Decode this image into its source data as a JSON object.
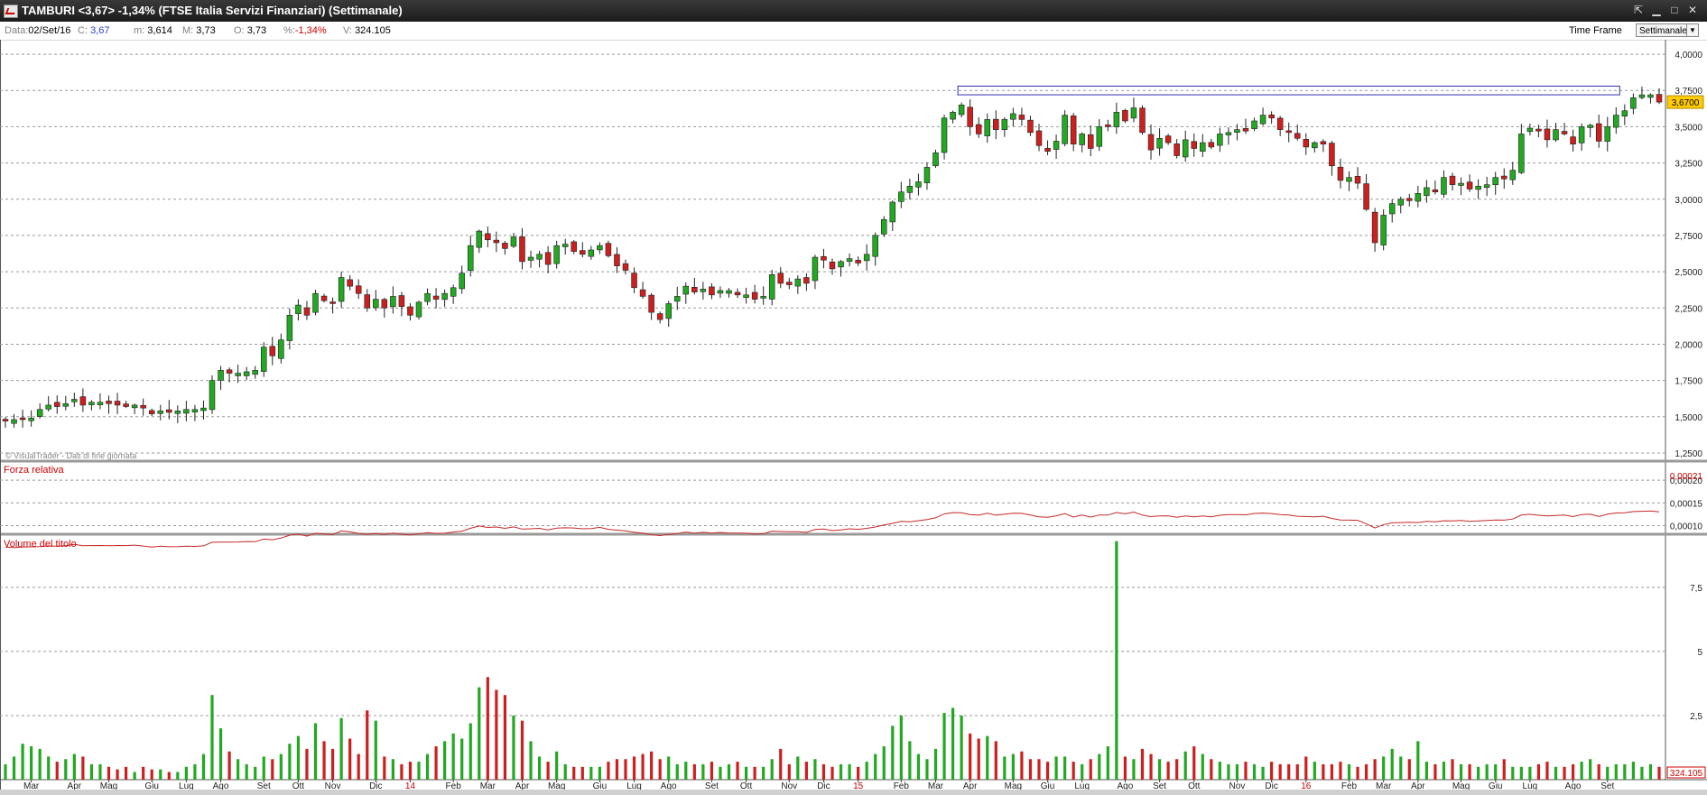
{
  "window": {
    "title": "TAMBURI <3,67> -1,34% (FTSE Italia Servizi Finanziari) (Settimanale)",
    "buttons": [
      "pin-icon",
      "minimize-icon",
      "maximize-icon",
      "close-icon"
    ]
  },
  "info": {
    "date_label": "Data:",
    "date_value": "02/Set/16",
    "close_label": "C:",
    "close_value": "3,67",
    "min_label": "m:",
    "min_value": "3,614",
    "max_label": "M:",
    "max_value": "3,73",
    "open_label": "O:",
    "open_value": "3,73",
    "pct_label": "%:",
    "pct_value": "-1,34%",
    "vol_label": "V:",
    "vol_value": "324.105",
    "timeframe_label": "Time Frame",
    "timeframe_value": "Settimanale"
  },
  "colors": {
    "up": "#22a822",
    "down": "#cc1f1f",
    "line": "#c62828",
    "rect": "#2f2fb0",
    "label_red": "#cc0000",
    "price_tag": "#ffcc00"
  },
  "chart_data": [
    {
      "type": "candlestick",
      "watermark": "© VisualTrader - Dati di fine giornata",
      "price_tag": "3,6700",
      "ylim": [
        1.2,
        4.1
      ],
      "yticks": [
        "4,0000",
        "3,7500",
        "3,5000",
        "3,2500",
        "3,0000",
        "2,7500",
        "2,5000",
        "2,2500",
        "2,0000",
        "1,7500",
        "1,5000",
        "1,2500"
      ],
      "ytick_values": [
        4.0,
        3.75,
        3.5,
        3.25,
        3.0,
        2.75,
        2.5,
        2.25,
        2.0,
        1.75,
        1.5,
        1.25
      ],
      "resistance_zone": {
        "y_low": 3.72,
        "y_high": 3.78,
        "from_week": 111,
        "to_week": 187
      },
      "closes": [
        1.47,
        1.48,
        1.48,
        1.49,
        1.55,
        1.58,
        1.57,
        1.59,
        1.62,
        1.58,
        1.6,
        1.6,
        1.59,
        1.58,
        1.57,
        1.58,
        1.56,
        1.52,
        1.54,
        1.53,
        1.54,
        1.55,
        1.55,
        1.56,
        1.75,
        1.82,
        1.8,
        1.8,
        1.81,
        1.82,
        1.98,
        1.92,
        2.03,
        2.2,
        2.27,
        2.2,
        2.35,
        2.3,
        2.28,
        2.46,
        2.4,
        2.35,
        2.25,
        2.31,
        2.25,
        2.33,
        2.26,
        2.2,
        2.29,
        2.35,
        2.31,
        2.35,
        2.39,
        2.49,
        2.68,
        2.78,
        2.72,
        2.7,
        2.66,
        2.74,
        2.57,
        2.6,
        2.62,
        2.55,
        2.68,
        2.69,
        2.64,
        2.62,
        2.65,
        2.68,
        2.61,
        2.54,
        2.51,
        2.39,
        2.33,
        2.22,
        2.17,
        2.28,
        2.33,
        2.4,
        2.36,
        2.38,
        2.34,
        2.37,
        2.37,
        2.34,
        2.34,
        2.31,
        2.33,
        2.48,
        2.42,
        2.41,
        2.45,
        2.42,
        2.6,
        2.58,
        2.52,
        2.57,
        2.59,
        2.56,
        2.62,
        2.75,
        2.86,
        2.98,
        3.05,
        3.09,
        3.12,
        3.22,
        3.32,
        3.56,
        3.6,
        3.65,
        3.5,
        3.45,
        3.55,
        3.48,
        3.55,
        3.59,
        3.55,
        3.46,
        3.37,
        3.33,
        3.4,
        3.58,
        3.38,
        3.45,
        3.35,
        3.5,
        3.5,
        3.6,
        3.54,
        3.63,
        3.46,
        3.34,
        3.42,
        3.39,
        3.3,
        3.41,
        3.35,
        3.39,
        3.36,
        3.45,
        3.46,
        3.48,
        3.47,
        3.54,
        3.58,
        3.56,
        3.48,
        3.46,
        3.42,
        3.36,
        3.39,
        3.38,
        3.23,
        3.13,
        3.15,
        3.11,
        2.93,
        2.7,
        2.89,
        2.97,
        3.0,
        2.99,
        3.04,
        3.08,
        3.05,
        3.15,
        3.1,
        3.11,
        3.07,
        3.09,
        3.1,
        3.15,
        3.14,
        3.2,
        3.45,
        3.49,
        3.47,
        3.41,
        3.48,
        3.45,
        3.38,
        3.5,
        3.51,
        3.4,
        3.5,
        3.58,
        3.61,
        3.7,
        3.72,
        3.72,
        3.67
      ],
      "volume_ylim": [
        0,
        9.5
      ],
      "volume_yticks": [
        "7,5",
        "5",
        "2,5"
      ],
      "volume_ytick_values": [
        7.5,
        5,
        2.5
      ],
      "volume_label": "Volume del titolo",
      "volume_last": "324.105",
      "volumes": [
        0.6,
        0.9,
        1.4,
        1.3,
        1.2,
        0.9,
        0.7,
        0.8,
        1.0,
        0.9,
        0.6,
        0.6,
        0.5,
        0.4,
        0.5,
        0.3,
        0.5,
        0.4,
        0.4,
        0.3,
        0.3,
        0.5,
        0.6,
        1.0,
        3.3,
        2.0,
        1.1,
        0.8,
        0.6,
        0.5,
        0.9,
        0.8,
        1.0,
        1.4,
        1.7,
        1.2,
        2.2,
        1.5,
        1.2,
        2.4,
        1.6,
        1.0,
        2.7,
        2.3,
        0.9,
        0.8,
        0.6,
        0.7,
        0.7,
        1.0,
        1.3,
        1.5,
        1.8,
        1.6,
        2.2,
        3.6,
        4.0,
        3.5,
        3.3,
        2.5,
        2.3,
        1.5,
        0.9,
        0.7,
        1.1,
        0.6,
        0.5,
        0.5,
        0.5,
        0.5,
        0.7,
        0.8,
        0.8,
        0.9,
        1.0,
        1.1,
        0.8,
        0.9,
        0.6,
        0.7,
        0.6,
        0.6,
        0.7,
        0.5,
        0.6,
        0.7,
        0.5,
        0.5,
        0.5,
        0.8,
        1.2,
        0.6,
        0.9,
        0.7,
        0.8,
        0.6,
        0.5,
        0.6,
        0.6,
        0.5,
        0.7,
        1.0,
        1.3,
        2.1,
        2.5,
        1.5,
        1.0,
        0.8,
        1.2,
        2.6,
        2.8,
        2.5,
        1.8,
        1.6,
        1.7,
        1.5,
        0.9,
        1.0,
        1.1,
        0.8,
        0.8,
        0.7,
        0.9,
        0.9,
        0.7,
        0.6,
        0.8,
        1.0,
        1.3,
        9.3,
        0.9,
        0.8,
        1.2,
        1.0,
        0.8,
        0.7,
        0.8,
        1.1,
        1.3,
        1.0,
        0.8,
        0.7,
        0.6,
        0.6,
        0.7,
        0.6,
        0.5,
        0.7,
        0.6,
        0.6,
        0.6,
        0.9,
        0.7,
        0.6,
        0.6,
        0.7,
        0.6,
        0.5,
        0.6,
        0.8,
        0.9,
        1.2,
        0.9,
        0.8,
        1.5,
        0.7,
        0.6,
        0.7,
        0.8,
        0.6,
        0.6,
        0.5,
        0.6,
        0.6,
        0.8,
        0.5,
        0.5,
        0.5,
        0.6,
        0.7,
        0.5,
        0.5,
        0.6,
        0.7,
        0.8,
        0.6,
        0.5,
        0.6,
        0.6,
        0.7,
        0.5,
        0.6,
        0.5,
        0.5,
        0.6,
        0.5,
        0.4,
        0.6
      ],
      "relative_strength_label": "Forza relativa",
      "relative_strength_last": "0,00021",
      "rs_ylim": [
        8.5e-05,
        0.00024
      ],
      "rs_yticks": [
        "0,00020",
        "0,00015",
        "0,00010"
      ],
      "rs_ytick_values": [
        0.0002,
        0.00015,
        0.0001
      ],
      "x_labels": [
        {
          "label": "Mar",
          "week": 3
        },
        {
          "label": "Apr",
          "week": 8
        },
        {
          "label": "Mag",
          "week": 12
        },
        {
          "label": "Giu",
          "week": 17
        },
        {
          "label": "Lug",
          "week": 21
        },
        {
          "label": "Ago",
          "week": 25
        },
        {
          "label": "Set",
          "week": 30
        },
        {
          "label": "Ott",
          "week": 34
        },
        {
          "label": "Nov",
          "week": 38
        },
        {
          "label": "Dic",
          "week": 43
        },
        {
          "label": "14",
          "week": 47,
          "year": true
        },
        {
          "label": "Feb",
          "week": 52
        },
        {
          "label": "Mar",
          "week": 56
        },
        {
          "label": "Apr",
          "week": 60
        },
        {
          "label": "Mag",
          "week": 64
        },
        {
          "label": "Giu",
          "week": 69
        },
        {
          "label": "Lug",
          "week": 73
        },
        {
          "label": "Ago",
          "week": 77
        },
        {
          "label": "Set",
          "week": 82
        },
        {
          "label": "Ott",
          "week": 86
        },
        {
          "label": "Nov",
          "week": 91
        },
        {
          "label": "Dic",
          "week": 95
        },
        {
          "label": "15",
          "week": 99,
          "year": true
        },
        {
          "label": "Feb",
          "week": 104
        },
        {
          "label": "Mar",
          "week": 108
        },
        {
          "label": "Apr",
          "week": 112
        },
        {
          "label": "Mag",
          "week": 117
        },
        {
          "label": "Giu",
          "week": 121
        },
        {
          "label": "Lug",
          "week": 125
        },
        {
          "label": "Ago",
          "week": 130
        },
        {
          "label": "Set",
          "week": 134
        },
        {
          "label": "Ott",
          "week": 138
        },
        {
          "label": "Nov",
          "week": 143
        },
        {
          "label": "Dic",
          "week": 147
        },
        {
          "label": "16",
          "week": 151,
          "year": true
        },
        {
          "label": "Feb",
          "week": 156
        },
        {
          "label": "Mar",
          "week": 160
        },
        {
          "label": "Apr",
          "week": 164
        },
        {
          "label": "Mag",
          "week": 169
        },
        {
          "label": "Giu",
          "week": 173
        },
        {
          "label": "Lug",
          "week": 177
        },
        {
          "label": "Ago",
          "week": 182
        },
        {
          "label": "Set",
          "week": 186
        }
      ]
    }
  ]
}
